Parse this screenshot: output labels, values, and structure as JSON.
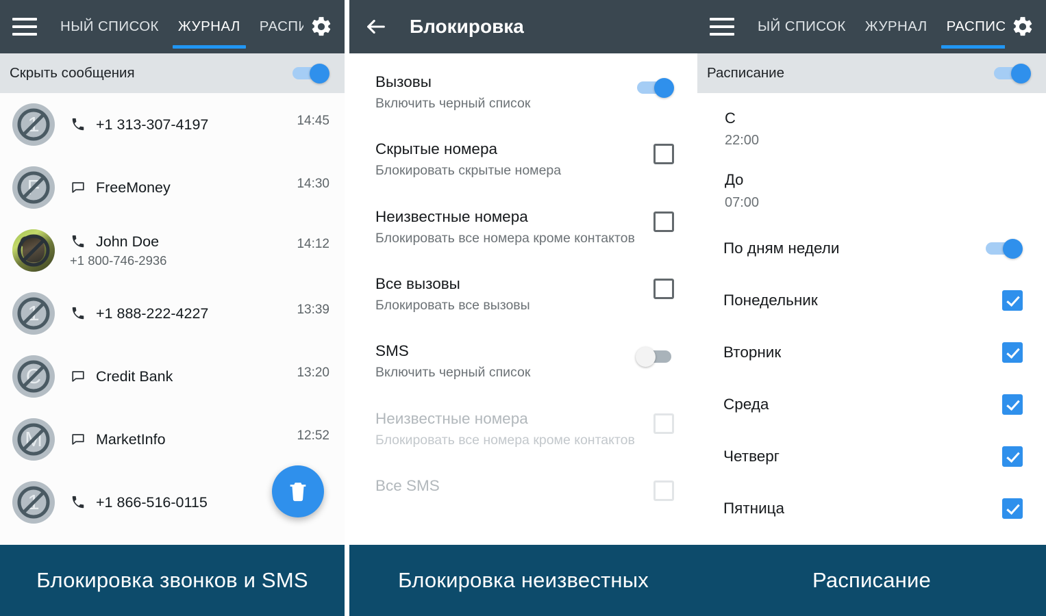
{
  "app": {
    "tabs": [
      "НЫЙ СПИСОК",
      "ЖУРНАЛ",
      "РАСПИСАНИЕ"
    ],
    "tabs_panel3": [
      "ЫЙ СПИСОК",
      "ЖУРНАЛ",
      "РАСПИСАНИЕ"
    ],
    "colors": {
      "appbar": "#3a4750",
      "accent": "#2f90ec",
      "strip": "#dfe3e6",
      "caption": "#0d4b6b"
    }
  },
  "panel1": {
    "strip": {
      "label": "Скрыть сообщения",
      "toggle_on": true
    },
    "active_tab": "ЖУРНАЛ",
    "rows": [
      {
        "avatar_letter": "1",
        "avatar_type": "blocked",
        "icon": "phone-icon",
        "name": "+1 313-307-4197",
        "sub": "",
        "time": "14:45"
      },
      {
        "avatar_letter": "F",
        "avatar_type": "blocked",
        "icon": "message-icon",
        "name": "FreeMoney",
        "sub": "",
        "time": "14:30"
      },
      {
        "avatar_letter": "",
        "avatar_type": "photo",
        "icon": "phone-icon",
        "name": "John Doe",
        "sub": "+1 800-746-2936",
        "time": "14:12"
      },
      {
        "avatar_letter": "1",
        "avatar_type": "blocked",
        "icon": "phone-icon",
        "name": "+1 888-222-4227",
        "sub": "",
        "time": "13:39"
      },
      {
        "avatar_letter": "C",
        "avatar_type": "blocked",
        "icon": "message-icon",
        "name": "Credit Bank",
        "sub": "",
        "time": "13:20"
      },
      {
        "avatar_letter": "M",
        "avatar_type": "blocked",
        "icon": "message-icon",
        "name": "MarketInfo",
        "sub": "",
        "time": "12:52"
      },
      {
        "avatar_letter": "1",
        "avatar_type": "blocked",
        "icon": "phone-icon",
        "name": "+1 866-516-0115",
        "sub": "",
        "time": ""
      }
    ],
    "fab": {
      "icon": "trash-icon"
    },
    "caption": "Блокировка звонков и SMS"
  },
  "panel2": {
    "title": "Блокировка",
    "back_icon": "back-arrow-icon",
    "rows": [
      {
        "title": "Вызовы",
        "sub": "Включить черный список",
        "control": "switch",
        "value": true,
        "dim": false
      },
      {
        "title": "Скрытые номера",
        "sub": "Блокировать скрытые номера",
        "control": "checkbox",
        "value": false,
        "dim": false
      },
      {
        "title": "Неизвестные номера",
        "sub": "Блокировать все номера кроме контактов",
        "control": "checkbox",
        "value": false,
        "dim": false
      },
      {
        "title": "Все вызовы",
        "sub": "Блокировать все вызовы",
        "control": "checkbox",
        "value": false,
        "dim": false
      },
      {
        "title": "SMS",
        "sub": "Включить черный список",
        "control": "switch",
        "value": false,
        "dim": false
      },
      {
        "title": "Неизвестные номера",
        "sub": "Блокировать все номера кроме контактов",
        "control": "checkbox",
        "value": false,
        "dim": true
      },
      {
        "title": "Все SMS",
        "sub": "",
        "control": "checkbox",
        "value": false,
        "dim": true
      }
    ],
    "caption": "Блокировка неизвестных"
  },
  "panel3": {
    "active_tab": "РАСПИСАНИЕ",
    "strip": {
      "label": "Расписание",
      "toggle_on": true
    },
    "time_rows": [
      {
        "title": "С",
        "value": "22:00"
      },
      {
        "title": "До",
        "value": "07:00"
      }
    ],
    "weekday_toggle": {
      "label": "По дням недели",
      "value": true
    },
    "days": [
      {
        "label": "Понедельник",
        "checked": true
      },
      {
        "label": "Вторник",
        "checked": true
      },
      {
        "label": "Среда",
        "checked": true
      },
      {
        "label": "Четверг",
        "checked": true
      },
      {
        "label": "Пятница",
        "checked": true
      }
    ],
    "caption": "Расписание"
  }
}
